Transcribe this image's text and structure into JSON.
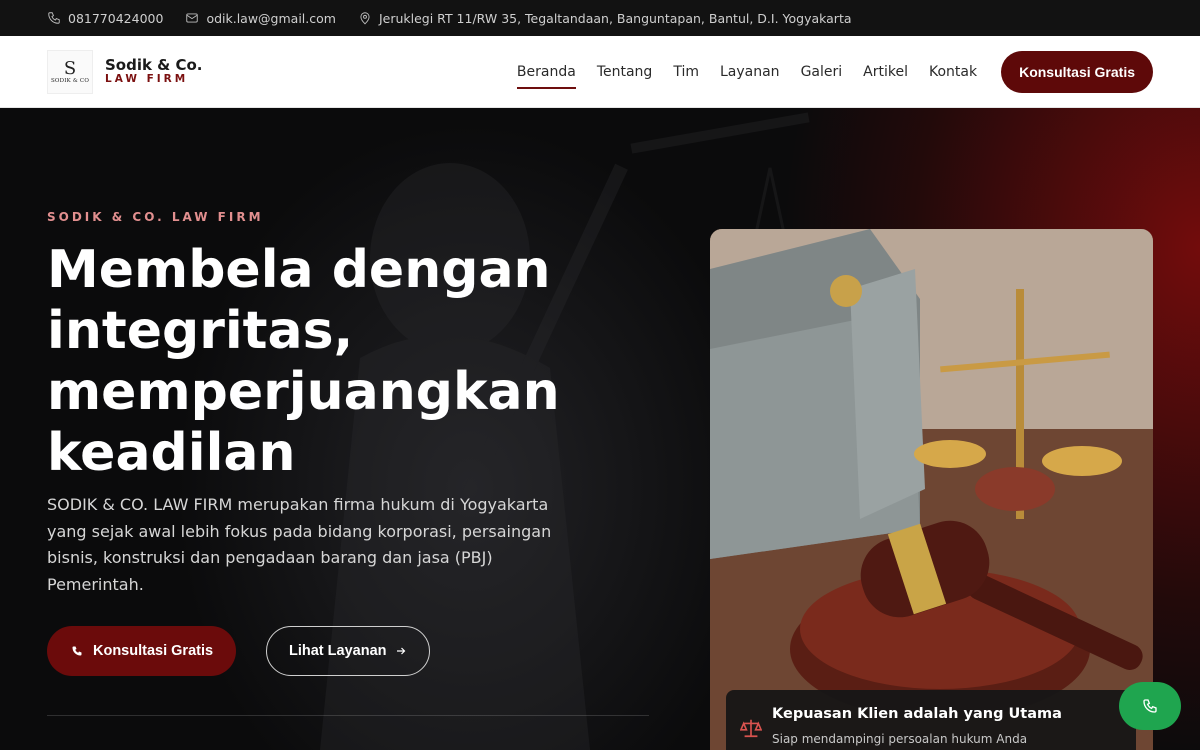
{
  "topbar": {
    "phone": "081770424000",
    "email": "odik.law@gmail.com",
    "address": "Jeruklegi RT 11/RW 35, Tegaltandaan, Banguntapan, Bantul, D.I. Yogyakarta"
  },
  "brand": {
    "logo_monogram": "S",
    "logo_caption": "SODIK & CO",
    "name": "Sodik & Co.",
    "tagline": "LAW FIRM"
  },
  "nav": {
    "items": [
      "Beranda",
      "Tentang",
      "Tim",
      "Layanan",
      "Galeri",
      "Artikel",
      "Kontak"
    ],
    "active": "Beranda",
    "cta": "Konsultasi Gratis"
  },
  "hero": {
    "kicker": "SODIK & CO. LAW FIRM",
    "headline": "Membela dengan integritas, memperjuangkan keadilan",
    "lead": "SODIK & CO. LAW FIRM merupakan firma hukum di Yogyakarta yang sejak awal lebih fokus pada bidang korporasi, persaingan bisnis, konstruksi dan pengadaan barang dan jasa (PBJ) Pemerintah.",
    "primary_button": "Konsultasi Gratis",
    "secondary_button": "Lihat Layanan"
  },
  "info_card": {
    "title": "Kepuasan Klien adalah yang Utama",
    "subtitle": "Siap mendampingi persoalan hukum Anda"
  },
  "colors": {
    "accent": "#6b0b0b",
    "whatsapp": "#1fa54f",
    "kicker": "#e28f8f"
  },
  "icons": {
    "phone": "phone-icon",
    "email": "mail-icon",
    "address": "map-pin-icon",
    "arrow": "arrow-right-icon",
    "scale": "scale-icon",
    "whatsapp": "whatsapp-phone-icon"
  }
}
